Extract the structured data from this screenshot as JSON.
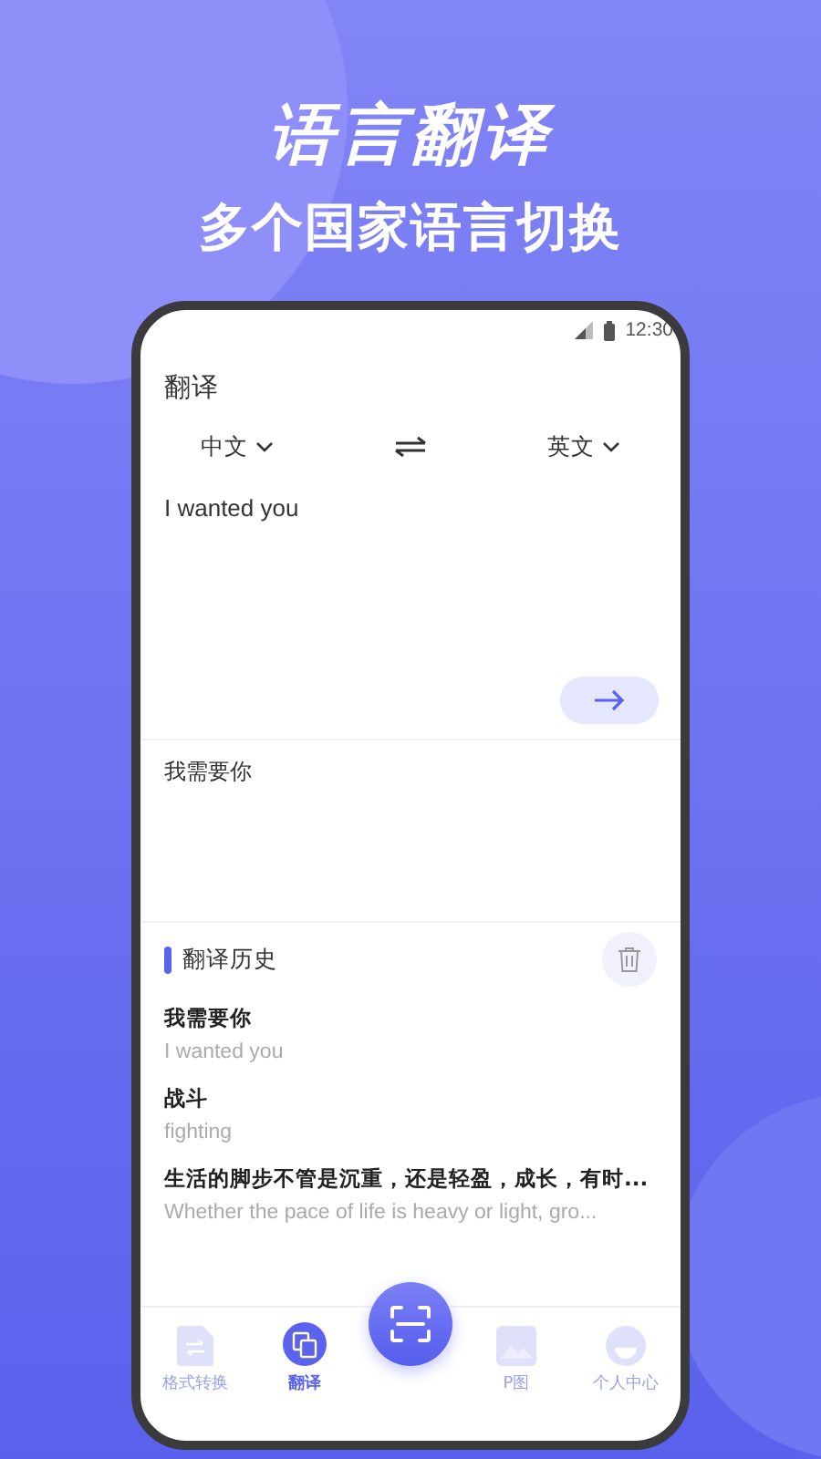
{
  "promo": {
    "title": "语言翻译",
    "subtitle": "多个国家语言切换"
  },
  "status_bar": {
    "time": "12:30"
  },
  "page": {
    "title": "翻译"
  },
  "languages": {
    "source": "中文",
    "target": "英文"
  },
  "input": {
    "value": "I wanted you"
  },
  "output": {
    "text": "我需要你"
  },
  "history": {
    "title": "翻译历史",
    "items": [
      {
        "source": "我需要你",
        "translation": "I wanted you"
      },
      {
        "source": "战斗",
        "translation": "fighting"
      },
      {
        "source": "生活的脚步不管是沉重，还是轻盈，成长，有时...",
        "translation": "Whether the pace of life is heavy or light, gro..."
      }
    ]
  },
  "nav": [
    {
      "kind": "document",
      "label": "格式转换",
      "selected": false
    },
    {
      "kind": "translate",
      "label": "翻译",
      "selected": true
    },
    {
      "kind": "scan"
    },
    {
      "kind": "image",
      "label": "P图",
      "selected": false
    },
    {
      "kind": "profile",
      "label": "个人中心",
      "selected": false
    }
  ]
}
